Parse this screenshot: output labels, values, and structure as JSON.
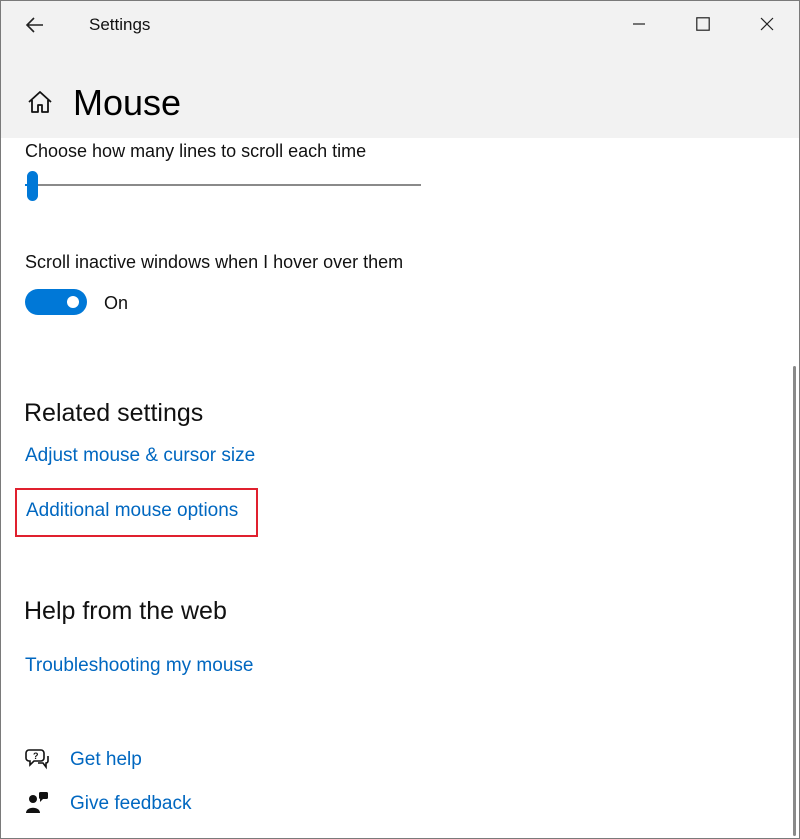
{
  "window": {
    "app_title": "Settings",
    "back_icon": "arrow-left-icon",
    "minimize_icon": "minimize-icon",
    "maximize_icon": "maximize-icon",
    "close_icon": "close-icon"
  },
  "header": {
    "home_icon": "home-icon",
    "title": "Mouse"
  },
  "scroll_lines": {
    "label": "Choose how many lines to scroll each time",
    "slider_level_fraction": 0.01
  },
  "inactive_scroll": {
    "label": "Scroll inactive windows when I hover over them",
    "state": "On",
    "enabled": true
  },
  "related_settings": {
    "title": "Related settings",
    "links": [
      "Adjust mouse & cursor size",
      "Additional mouse options"
    ]
  },
  "help_web": {
    "title": "Help from the web",
    "links": [
      "Troubleshooting my mouse"
    ]
  },
  "footer": {
    "get_help": "Get help",
    "get_help_icon": "chat-help-icon",
    "give_feedback": "Give feedback",
    "give_feedback_icon": "feedback-person-icon"
  },
  "colors": {
    "accent": "#0078d7",
    "link": "#0067c0",
    "highlight_border": "#e0202e",
    "topbar_bg": "#f2f2f2"
  }
}
